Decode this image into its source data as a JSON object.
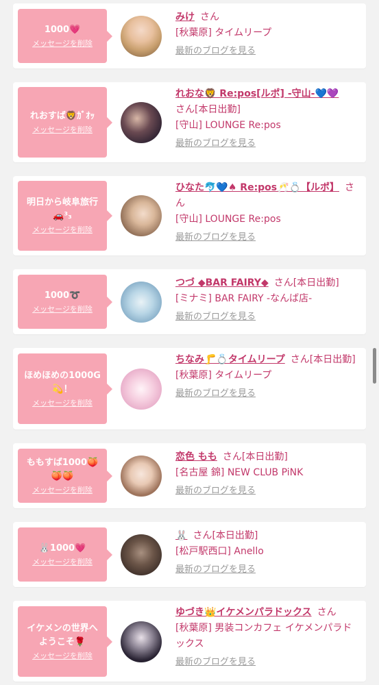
{
  "delete_label": "メッセージを削除",
  "blog_label": "最新のブログを見る",
  "san_label": "さん",
  "cards": [
    {
      "message": "1000💗",
      "name": "みけ",
      "status": "",
      "shop": "[秋葉原] タイムリープ"
    },
    {
      "message": "れおすば🦁ｶﾞｵｯ",
      "name": "れおな🦁 Re:pos[ルポ] -守山-💙💜",
      "status": "[本日出勤]",
      "shop": "[守山] LOUNGE Re:pos"
    },
    {
      "message": "明日から岐阜旅行🚗³₃",
      "name": "ひなた🐬💙♠ Re:pos🥂💍【ルポ】",
      "status": "",
      "shop": "[守山] LOUNGE Re:pos"
    },
    {
      "message": "1000➰",
      "name": "つづ ◆BAR FAIRY◆",
      "status": "[本日出勤]",
      "shop": "[ミナミ] BAR FAIRY -なんば店-"
    },
    {
      "message": "ほめほめの1000G💫！",
      "name": "ちなみ🦵💍タイムリープ",
      "status": "[本日出勤]",
      "shop": "[秋葉原] タイムリープ"
    },
    {
      "message": "ももすば1000🍑🍑🍑",
      "name": "恋色 もも",
      "status": "[本日出勤]",
      "shop": "[名古屋 錦] NEW CLUB PiNK"
    },
    {
      "message": "🐰1000💗",
      "name": "🐰",
      "status": "[本日出勤]",
      "shop": "[松戸駅西口] Anello"
    },
    {
      "message": "イケメンの世界へようこそ🌹",
      "name": "ゆづき👑イケメンパラドックス",
      "status": "",
      "shop": "[秋葉原] 男装コンカフェ イケメンパラドックス"
    }
  ],
  "colors": {
    "accent": "#c2386a",
    "bubble": "#f7a6b4",
    "muted": "#9a9a9a"
  }
}
